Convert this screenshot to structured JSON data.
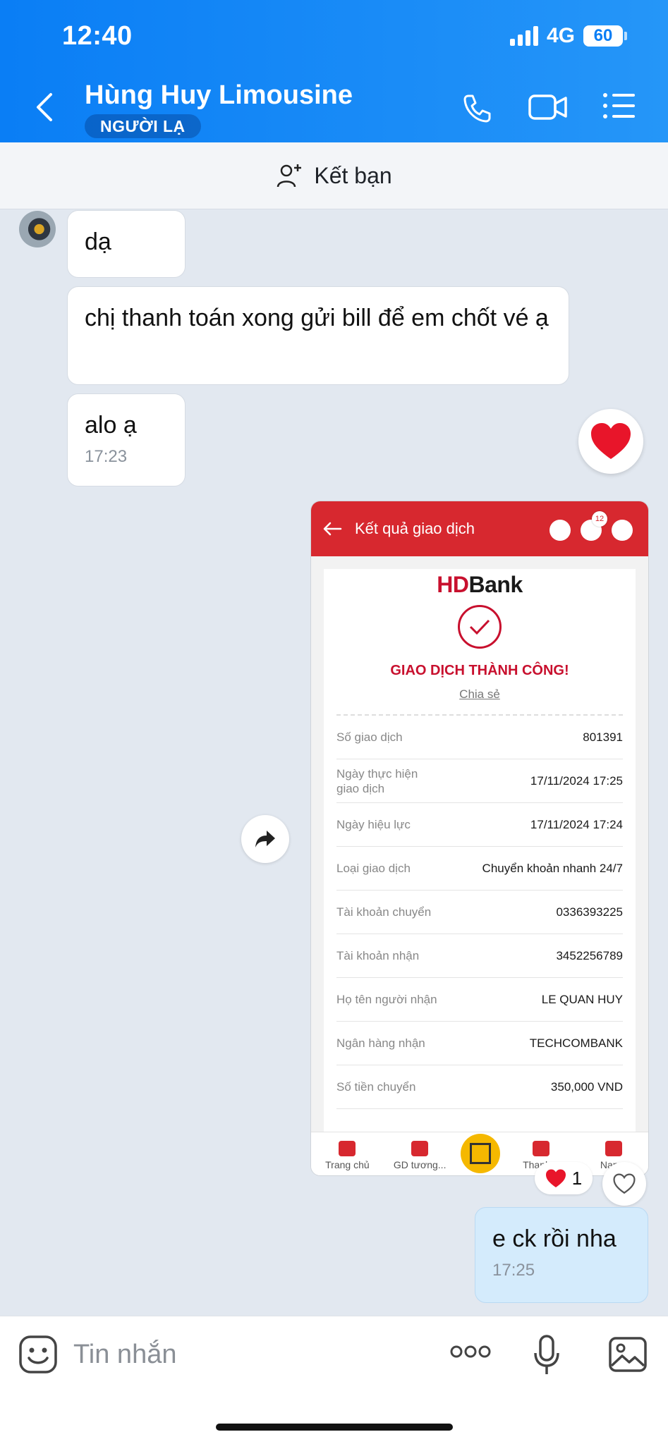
{
  "status": {
    "time": "12:40",
    "network": "4G",
    "battery": "60"
  },
  "header": {
    "contact_name": "Hùng Huy Limousine",
    "badge": "NGƯỜI LẠ"
  },
  "friend_bar": {
    "label": "Kết bạn"
  },
  "messages": [
    {
      "text": "dạ"
    },
    {
      "text": "chị thanh toán xong gửi bill để em chốt vé ạ"
    },
    {
      "text": "alo ạ",
      "time": "17:23"
    },
    {
      "text": "e ck rồi nha",
      "time": "17:25"
    }
  ],
  "receipt": {
    "header_title": "Kết quả giao dịch",
    "notification_count": "12",
    "logo_hd": "HD",
    "logo_bank": "Bank",
    "status": "GIAO DỊCH THÀNH CÔNG!",
    "share": "Chia sẻ",
    "rows": [
      {
        "key": "Số giao dịch",
        "value": "801391"
      },
      {
        "key": "Ngày thực hiện giao dịch",
        "value": "17/11/2024 17:25"
      },
      {
        "key": "Ngày hiệu lực",
        "value": "17/11/2024 17:24"
      },
      {
        "key": "Loại giao dịch",
        "value": "Chuyển khoản nhanh 24/7"
      },
      {
        "key": "Tài khoản chuyển",
        "value": "0336393225"
      },
      {
        "key": "Tài khoản nhận",
        "value": "3452256789"
      },
      {
        "key": "Họ tên người nhận",
        "value": "LE QUAN HUY"
      },
      {
        "key": "Ngân hàng nhận",
        "value": "TECHCOMBANK"
      },
      {
        "key": "Số tiền chuyển",
        "value": "350,000 VND"
      }
    ],
    "nav": [
      "Trang chủ",
      "GD tương...",
      "Thanh...",
      "Nạp..."
    ]
  },
  "reactions": {
    "heart_count": "1"
  },
  "input": {
    "placeholder": "Tin nhắn"
  },
  "colors": {
    "header_blue": "#0a7ef5",
    "sent_bubble": "#d4ebfc",
    "bank_red": "#d7282f",
    "heart": "#e8152a"
  }
}
